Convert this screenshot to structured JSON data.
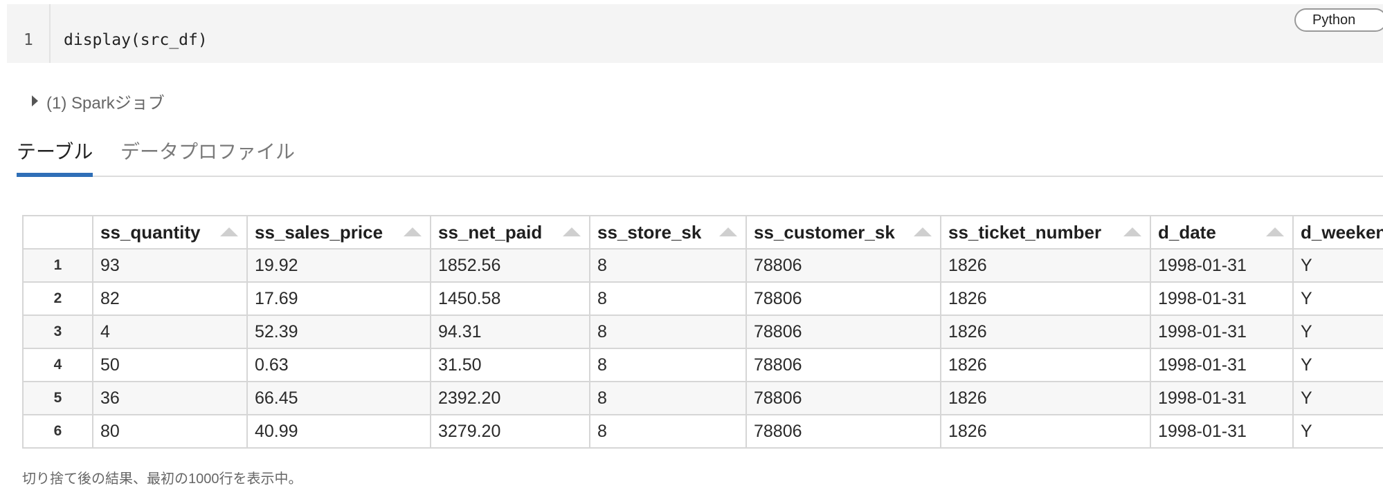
{
  "code_cell": {
    "line_number": "1",
    "code": "display(src_df)",
    "language": "Python"
  },
  "spark_jobs": {
    "label": "(1) Sparkジョブ"
  },
  "tabs": [
    {
      "label": "テーブル",
      "active": true
    },
    {
      "label": "データプロファイル",
      "active": false
    }
  ],
  "table": {
    "columns": [
      "ss_quantity",
      "ss_sales_price",
      "ss_net_paid",
      "ss_store_sk",
      "ss_customer_sk",
      "ss_ticket_number",
      "d_date",
      "d_weekend"
    ],
    "rows": [
      {
        "n": "1",
        "cells": [
          "93",
          "19.92",
          "1852.56",
          "8",
          "78806",
          "1826",
          "1998-01-31",
          "Y"
        ]
      },
      {
        "n": "2",
        "cells": [
          "82",
          "17.69",
          "1450.58",
          "8",
          "78806",
          "1826",
          "1998-01-31",
          "Y"
        ]
      },
      {
        "n": "3",
        "cells": [
          "4",
          "52.39",
          "94.31",
          "8",
          "78806",
          "1826",
          "1998-01-31",
          "Y"
        ]
      },
      {
        "n": "4",
        "cells": [
          "50",
          "0.63",
          "31.50",
          "8",
          "78806",
          "1826",
          "1998-01-31",
          "Y"
        ]
      },
      {
        "n": "5",
        "cells": [
          "36",
          "66.45",
          "2392.20",
          "8",
          "78806",
          "1826",
          "1998-01-31",
          "Y"
        ]
      },
      {
        "n": "6",
        "cells": [
          "80",
          "40.99",
          "3279.20",
          "8",
          "78806",
          "1826",
          "1998-01-31",
          "Y"
        ]
      }
    ],
    "footer": "切り捨て後の結果、最初の1000行を表示中。"
  },
  "colors": {
    "tab_underline": "#2f6fb7",
    "cell_bg": "#f4f4f4"
  },
  "icons": {
    "sort": "sort-asc-icon",
    "expand": "caret-right-icon"
  }
}
